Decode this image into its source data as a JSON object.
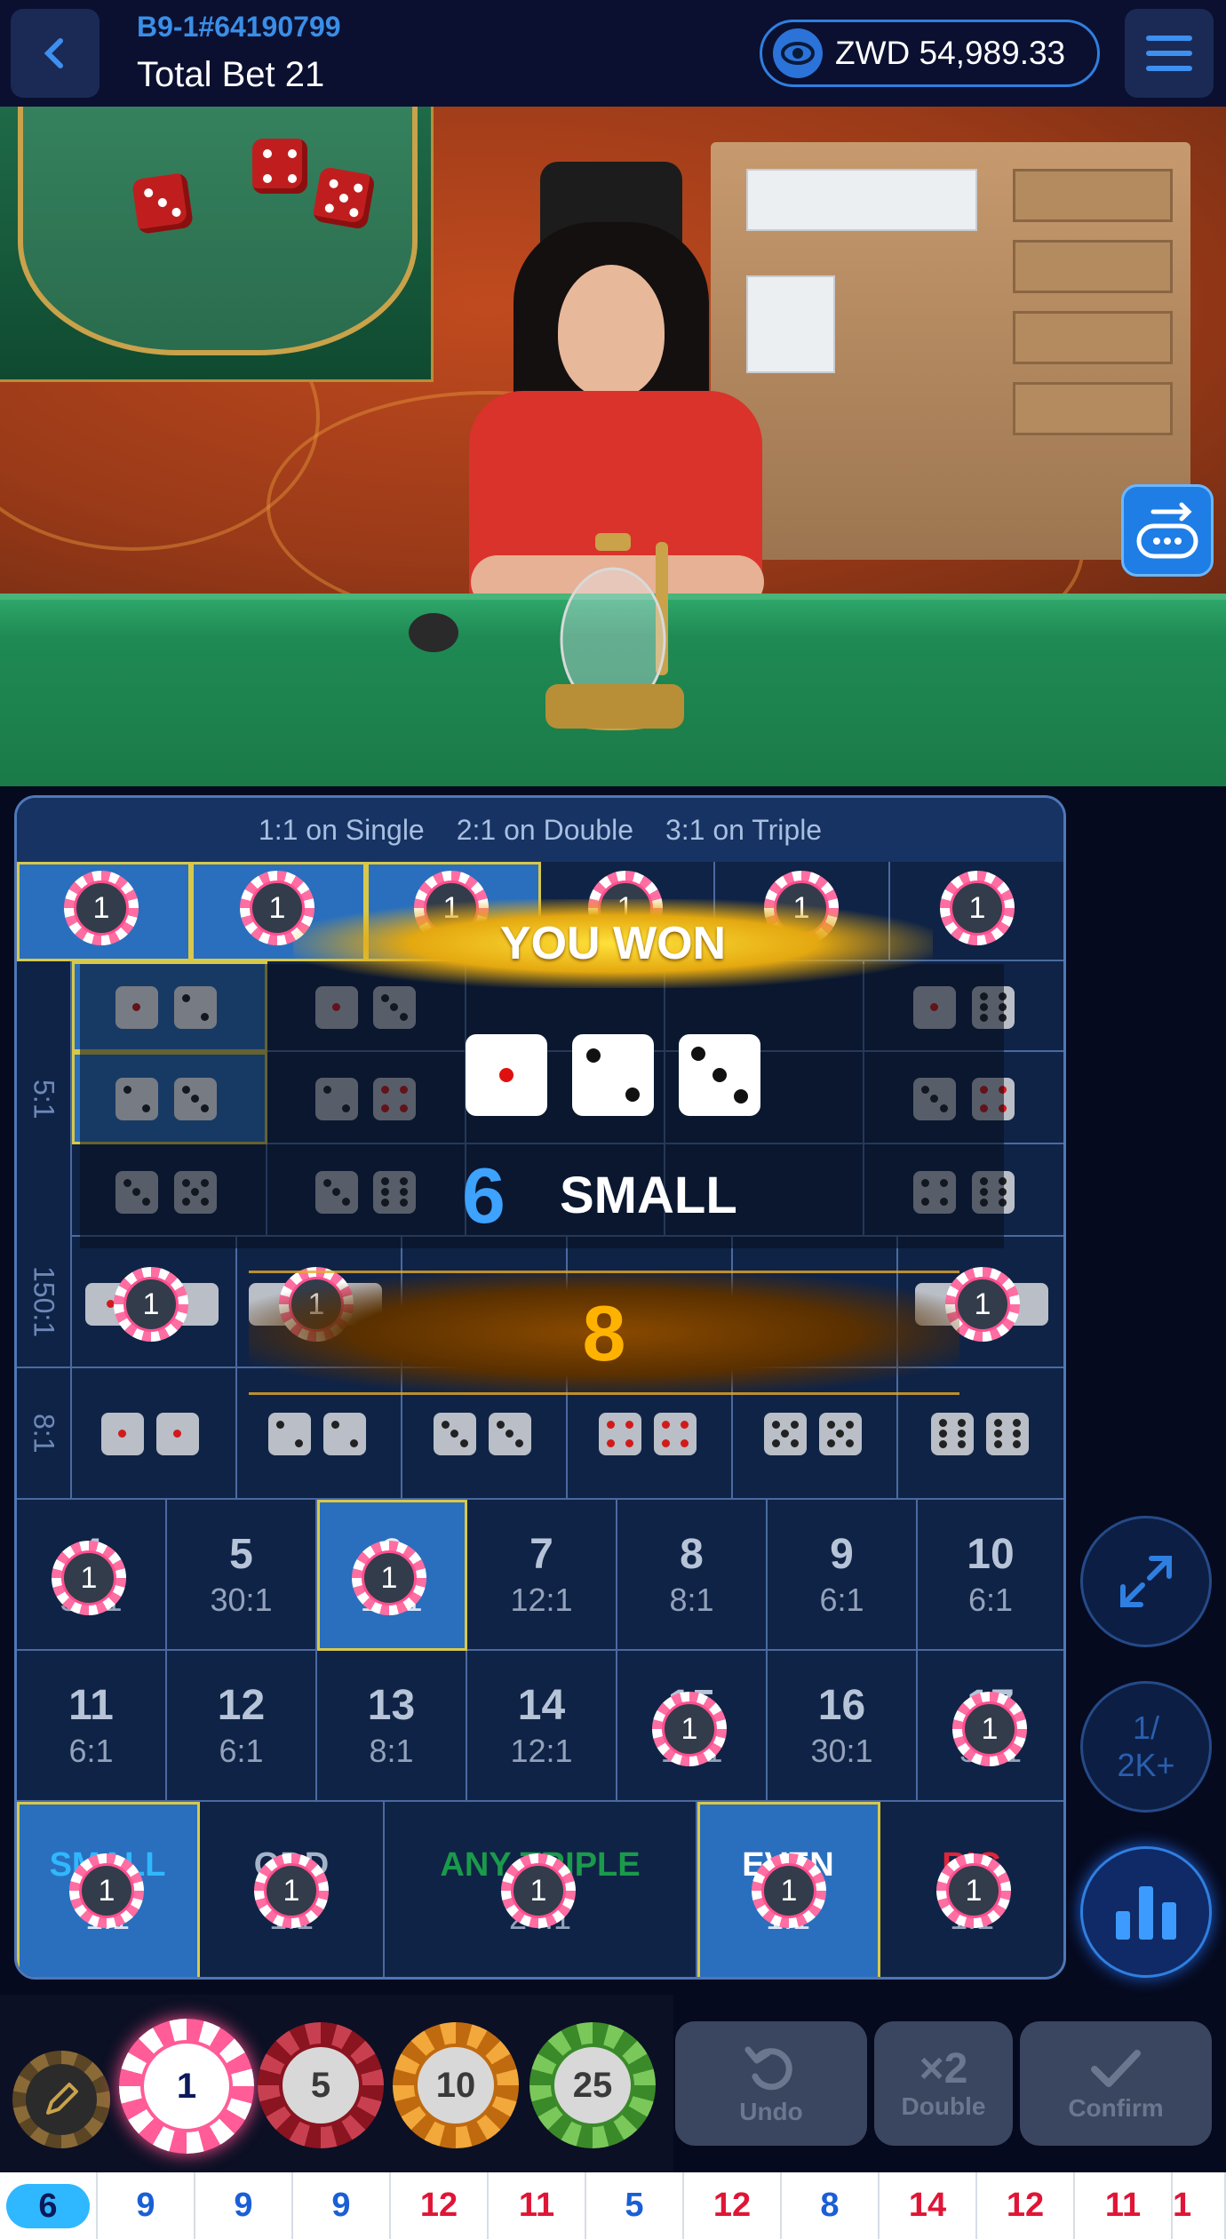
{
  "header": {
    "table_id": "B9-1#64190799",
    "total_bet": "Total Bet 21",
    "currency": "ZWD",
    "balance": "54,989.33"
  },
  "board": {
    "header": [
      "1:1 on Single",
      "2:1 on Double",
      "3:1 on Triple"
    ],
    "side_labels": [
      "5:1",
      "150:1",
      "8:1"
    ],
    "totals": [
      {
        "num": "4",
        "pay": "50:1"
      },
      {
        "num": "5",
        "pay": "30:1"
      },
      {
        "num": "6",
        "pay": "18:1"
      },
      {
        "num": "7",
        "pay": "12:1"
      },
      {
        "num": "8",
        "pay": "8:1"
      },
      {
        "num": "9",
        "pay": "6:1"
      },
      {
        "num": "10",
        "pay": "6:1"
      },
      {
        "num": "11",
        "pay": "6:1"
      },
      {
        "num": "12",
        "pay": "6:1"
      },
      {
        "num": "13",
        "pay": "8:1"
      },
      {
        "num": "14",
        "pay": "12:1"
      },
      {
        "num": "15",
        "pay": "18:1"
      },
      {
        "num": "16",
        "pay": "30:1"
      },
      {
        "num": "17",
        "pay": "50:1"
      }
    ],
    "bottom": [
      {
        "label": "SMALL",
        "pay": "1:1"
      },
      {
        "label": "ODD",
        "pay": "1:1"
      },
      {
        "label": "ANY TRIPLE",
        "pay": "24:1"
      },
      {
        "label": "EVEN",
        "pay": "1:1"
      },
      {
        "label": "BIG",
        "pay": "1:1"
      }
    ],
    "chip_value": "1"
  },
  "result": {
    "banner": "YOU WON",
    "dice": [
      1,
      3,
      3
    ],
    "sum": "6",
    "outcome": "SMALL",
    "bonus": "8"
  },
  "tools": {
    "limits": "1/\n2K+"
  },
  "chips": [
    "1",
    "5",
    "10",
    "25"
  ],
  "actions": {
    "undo": "Undo",
    "double_icon": "×2",
    "double": "Double",
    "confirm": "Confirm"
  },
  "road": [
    "6",
    "9",
    "9",
    "9",
    "12",
    "11",
    "5",
    "12",
    "8",
    "14",
    "12",
    "11",
    "1"
  ],
  "colors": {
    "accent": "#2f7fe0",
    "selected_cell": "#2a6fbd",
    "gold": "#ffb300",
    "road_red": "#e01536",
    "road_blue": "#1a5fd6"
  }
}
